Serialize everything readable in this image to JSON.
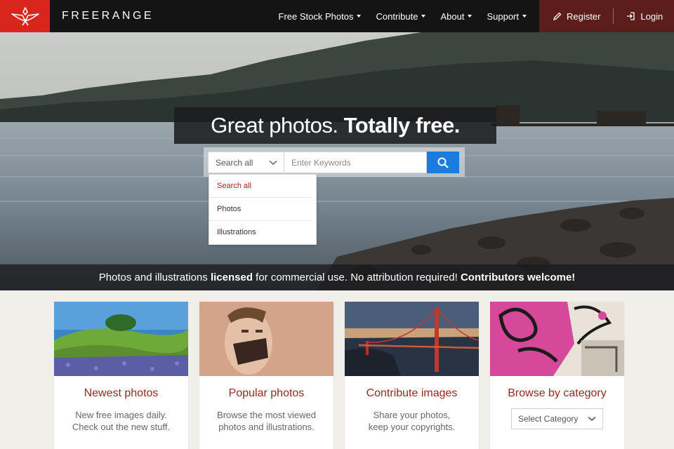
{
  "brand": {
    "name": "FREERANGE",
    "logo_icon": "bird-logo-icon",
    "accent": "#d9261c"
  },
  "nav": {
    "items": [
      {
        "label": "Free Stock Photos"
      },
      {
        "label": "Contribute"
      },
      {
        "label": "About"
      },
      {
        "label": "Support"
      }
    ],
    "register_label": "Register",
    "login_label": "Login"
  },
  "hero": {
    "headline_light": "Great photos.",
    "headline_bold": "Totally free.",
    "search": {
      "scope_selected": "Search all",
      "placeholder": "Enter Keywords",
      "button_icon": "search-icon",
      "options": [
        "Search all",
        "Photos",
        "Illustrations"
      ]
    },
    "tagline": {
      "part1": "Photos and illustrations ",
      "part2_bold": "licensed",
      "part3": " for commercial use. No attribution required! ",
      "part4_bold": "Contributors welcome!"
    }
  },
  "cards": [
    {
      "title": "Newest photos",
      "line1": "New free images daily.",
      "line2": "Check out the new stuff."
    },
    {
      "title": "Popular photos",
      "line1": "Browse the most viewed",
      "line2": "photos and illustrations."
    },
    {
      "title": "Contribute images",
      "line1": "Share your photos,",
      "line2": "keep your copyrights."
    },
    {
      "title": "Browse by category",
      "select_label": "Select Category"
    }
  ],
  "colors": {
    "card_title": "#922a1f",
    "search_button": "#1a7cdf",
    "account_bg": "#5c1e1b"
  }
}
